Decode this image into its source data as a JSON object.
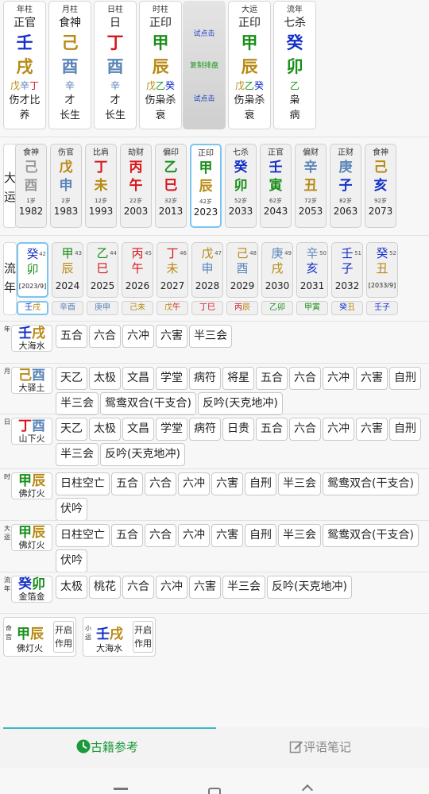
{
  "pillars": [
    {
      "label": "年柱",
      "god": "正官",
      "stem": "壬",
      "branch": "戌",
      "stem_color": "c-water",
      "branch_color": "c-earth",
      "hidden": [
        {
          "t": "戊",
          "c": "c-earth"
        },
        {
          "t": "辛",
          "c": "c-metal"
        },
        {
          "t": "丁",
          "c": "c-fire"
        }
      ],
      "hidden_gods": "伤才比",
      "stage": "养"
    },
    {
      "label": "月柱",
      "god": "食神",
      "stem": "己",
      "branch": "酉",
      "stem_color": "c-earth",
      "branch_color": "c-metal",
      "hidden": [
        {
          "t": "辛",
          "c": "c-metal"
        }
      ],
      "hidden_gods": "才",
      "stage": "长生"
    },
    {
      "label": "日柱",
      "god": "日",
      "stem": "丁",
      "branch": "酉",
      "stem_color": "c-fire",
      "branch_color": "c-metal",
      "hidden": [
        {
          "t": "辛",
          "c": "c-metal"
        }
      ],
      "hidden_gods": "才",
      "stage": "长生"
    },
    {
      "label": "时柱",
      "god": "正印",
      "stem": "甲",
      "branch": "辰",
      "stem_color": "c-wood",
      "branch_color": "c-earth",
      "hidden": [
        {
          "t": "戊",
          "c": "c-earth"
        },
        {
          "t": "乙",
          "c": "c-wood"
        },
        {
          "t": "癸",
          "c": "c-water"
        }
      ],
      "hidden_gods": "伤枭杀",
      "stage": "衰"
    },
    {
      "label": "大运",
      "god": "正印",
      "stem": "甲",
      "branch": "辰",
      "stem_color": "c-wood",
      "branch_color": "c-earth",
      "hidden": [
        {
          "t": "戊",
          "c": "c-earth"
        },
        {
          "t": "乙",
          "c": "c-wood"
        },
        {
          "t": "癸",
          "c": "c-water"
        }
      ],
      "hidden_gods": "伤枭杀",
      "stage": "衰"
    },
    {
      "label": "流年",
      "god": "七杀",
      "stem": "癸",
      "branch": "卯",
      "stem_color": "c-water",
      "branch_color": "c-wood",
      "hidden": [
        {
          "t": "乙",
          "c": "c-wood"
        }
      ],
      "hidden_gods": "枭",
      "stage": "病"
    }
  ],
  "actions": {
    "try1": "试点击",
    "copy": "复制排盘",
    "try2": "试点击"
  },
  "dayun_label": "大运",
  "dayun": [
    {
      "god": "食神",
      "stem": "己",
      "branch": "酉",
      "sc": "c-gray",
      "bc": "c-gray",
      "age": "1岁",
      "year": "1982",
      "dim": true
    },
    {
      "god": "伤官",
      "stem": "戊",
      "branch": "申",
      "sc": "c-earth",
      "bc": "c-metal",
      "age": "2岁",
      "year": "1983"
    },
    {
      "god": "比肩",
      "stem": "丁",
      "branch": "未",
      "sc": "c-fire",
      "bc": "c-earth",
      "age": "12岁",
      "year": "1993"
    },
    {
      "god": "劫财",
      "stem": "丙",
      "branch": "午",
      "sc": "c-fire",
      "bc": "c-fire",
      "age": "22岁",
      "year": "2003"
    },
    {
      "god": "偏印",
      "stem": "乙",
      "branch": "巳",
      "sc": "c-wood",
      "bc": "c-fire",
      "age": "32岁",
      "year": "2013"
    },
    {
      "god": "正印",
      "stem": "甲",
      "branch": "辰",
      "sc": "c-wood",
      "bc": "c-earth",
      "age": "42岁",
      "year": "2023",
      "sel": true
    },
    {
      "god": "七杀",
      "stem": "癸",
      "branch": "卯",
      "sc": "c-water",
      "bc": "c-wood",
      "age": "52岁",
      "year": "2033"
    },
    {
      "god": "正官",
      "stem": "壬",
      "branch": "寅",
      "sc": "c-water",
      "bc": "c-wood",
      "age": "62岁",
      "year": "2043"
    },
    {
      "god": "偏财",
      "stem": "辛",
      "branch": "丑",
      "sc": "c-metal",
      "bc": "c-earth",
      "age": "72岁",
      "year": "2053"
    },
    {
      "god": "正财",
      "stem": "庚",
      "branch": "子",
      "sc": "c-metal",
      "bc": "c-water",
      "age": "82岁",
      "year": "2063"
    },
    {
      "god": "食神",
      "stem": "己",
      "branch": "亥",
      "sc": "c-earth",
      "bc": "c-water",
      "age": "92岁",
      "year": "2073"
    }
  ],
  "liunian_label": "流年",
  "liunian": [
    {
      "stem": "癸",
      "branch": "卯",
      "sc": "c-water",
      "bc": "c-wood",
      "age": "42",
      "year": "[2023/9]",
      "small": true,
      "sel": true
    },
    {
      "stem": "甲",
      "branch": "辰",
      "sc": "c-wood",
      "bc": "c-earth",
      "age": "43",
      "year": "2024"
    },
    {
      "stem": "乙",
      "branch": "巳",
      "sc": "c-wood",
      "bc": "c-fire",
      "age": "44",
      "year": "2025"
    },
    {
      "stem": "丙",
      "branch": "午",
      "sc": "c-fire",
      "bc": "c-fire",
      "age": "45",
      "year": "2026"
    },
    {
      "stem": "丁",
      "branch": "未",
      "sc": "c-fire",
      "bc": "c-earth",
      "age": "46",
      "year": "2027"
    },
    {
      "stem": "戊",
      "branch": "申",
      "sc": "c-earth",
      "bc": "c-metal",
      "age": "47",
      "year": "2028"
    },
    {
      "stem": "己",
      "branch": "酉",
      "sc": "c-earth",
      "bc": "c-metal",
      "age": "48",
      "year": "2029"
    },
    {
      "stem": "庚",
      "branch": "戌",
      "sc": "c-metal",
      "bc": "c-earth",
      "age": "49",
      "year": "2030"
    },
    {
      "stem": "辛",
      "branch": "亥",
      "sc": "c-metal",
      "bc": "c-water",
      "age": "50",
      "year": "2031"
    },
    {
      "stem": "壬",
      "branch": "子",
      "sc": "c-water",
      "bc": "c-water",
      "age": "51",
      "year": "2032"
    },
    {
      "stem": "癸",
      "branch": "丑",
      "sc": "c-water",
      "bc": "c-earth",
      "age": "52",
      "year": "[2033/9]",
      "small": true
    }
  ],
  "liuyue": [
    {
      "t1": "壬",
      "c1": "c-water",
      "t2": "戌",
      "c2": "c-earth",
      "sel": true
    },
    {
      "t1": "辛",
      "c1": "c-metal",
      "t2": "酉",
      "c2": "c-metal"
    },
    {
      "t1": "庚",
      "c1": "c-metal",
      "t2": "申",
      "c2": "c-metal"
    },
    {
      "t1": "己",
      "c1": "c-earth",
      "t2": "未",
      "c2": "c-earth"
    },
    {
      "t1": "戊",
      "c1": "c-earth",
      "t2": "午",
      "c2": "c-fire"
    },
    {
      "t1": "丁",
      "c1": "c-fire",
      "t2": "巳",
      "c2": "c-fire"
    },
    {
      "t1": "丙",
      "c1": "c-fire",
      "t2": "辰",
      "c2": "c-earth"
    },
    {
      "t1": "乙",
      "c1": "c-wood",
      "t2": "卯",
      "c2": "c-wood"
    },
    {
      "t1": "甲",
      "c1": "c-wood",
      "t2": "寅",
      "c2": "c-wood"
    },
    {
      "t1": "癸",
      "c1": "c-water",
      "t2": "丑",
      "c2": "c-earth"
    },
    {
      "t1": "壬",
      "c1": "c-water",
      "t2": "子",
      "c2": "c-water"
    }
  ],
  "relations": [
    {
      "side": "年",
      "s": "壬",
      "sc": "c-water",
      "b": "戌",
      "bc": "c-earth",
      "nayin": "大海水",
      "chips": [
        "五合",
        "六合",
        "六冲",
        "六害",
        "半三会"
      ]
    },
    {
      "side": "月",
      "s": "己",
      "sc": "c-earth",
      "b": "酉",
      "bc": "c-metal",
      "nayin": "大驿土",
      "chips": [
        "天乙",
        "太极",
        "文昌",
        "学堂",
        "病符",
        "将星",
        "五合",
        "六合",
        "六冲",
        "六害",
        "自刑",
        "半三会",
        "鸳鸯双合(干支合)",
        "反吟(天克地冲)"
      ]
    },
    {
      "side": "日",
      "s": "丁",
      "sc": "c-fire",
      "b": "酉",
      "bc": "c-metal",
      "nayin": "山下火",
      "chips": [
        "天乙",
        "太极",
        "文昌",
        "学堂",
        "病符",
        "日贵",
        "五合",
        "六合",
        "六冲",
        "六害",
        "自刑",
        "半三会",
        "反吟(天克地冲)"
      ]
    },
    {
      "side": "时",
      "s": "甲",
      "sc": "c-wood",
      "b": "辰",
      "bc": "c-earth",
      "nayin": "佛灯火",
      "chips": [
        "日柱空亡",
        "五合",
        "六合",
        "六冲",
        "六害",
        "自刑",
        "半三会",
        "鸳鸯双合(干支合)",
        "伏吟"
      ]
    },
    {
      "side": "大运",
      "s": "甲",
      "sc": "c-wood",
      "b": "辰",
      "bc": "c-earth",
      "nayin": "佛灯火",
      "chips": [
        "日柱空亡",
        "五合",
        "六合",
        "六冲",
        "六害",
        "自刑",
        "半三会",
        "鸳鸯双合(干支合)",
        "伏吟"
      ]
    },
    {
      "side": "流年",
      "s": "癸",
      "sc": "c-water",
      "b": "卯",
      "bc": "c-wood",
      "nayin": "金箔金",
      "chips": [
        "太极",
        "桃花",
        "六合",
        "六冲",
        "六害",
        "半三会",
        "反吟(天克地冲)"
      ]
    }
  ],
  "minggong": {
    "label": "命宫",
    "s": "甲",
    "sc": "c-wood",
    "b": "辰",
    "bc": "c-earth",
    "nayin": "佛灯火",
    "open": "开启作用"
  },
  "xiaoyun": {
    "label": "小运",
    "s": "壬",
    "sc": "c-water",
    "b": "戌",
    "bc": "c-earth",
    "nayin": "大海水",
    "open": "开启作用"
  },
  "tabs": {
    "active": "古籍参考",
    "inactive": "评语笔记"
  },
  "accent": "#1a9a3a"
}
